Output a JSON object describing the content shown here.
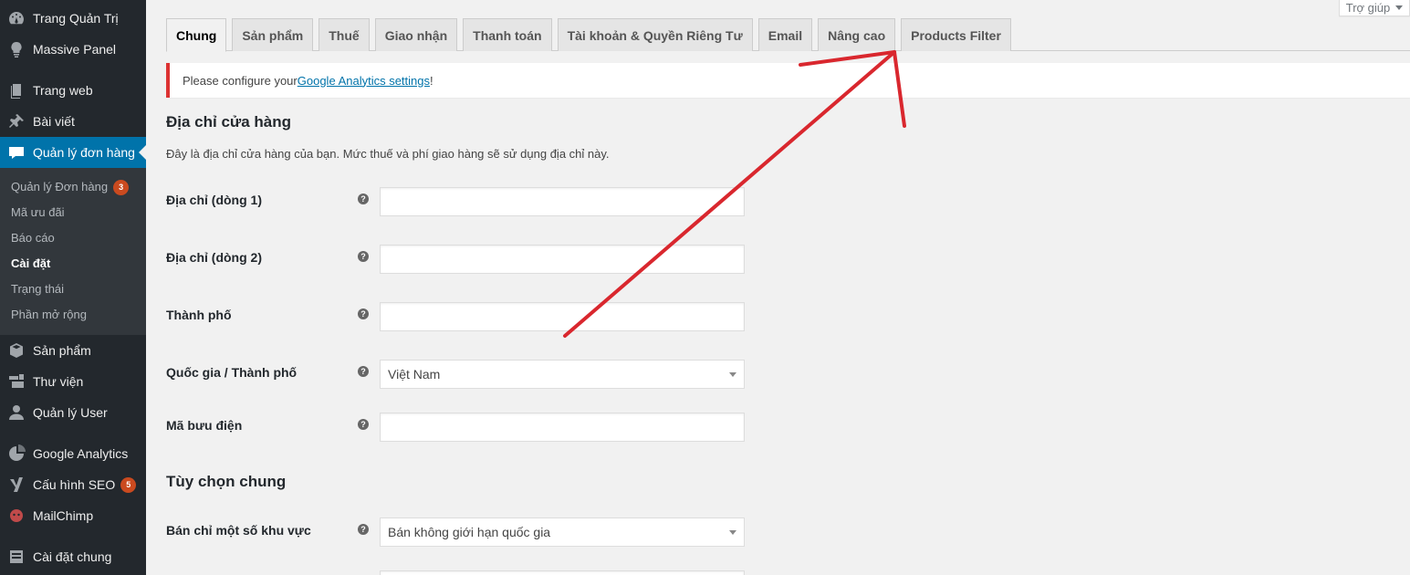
{
  "sidebar": {
    "items": [
      {
        "label": "Trang Quản Trị",
        "icon": "dashboard-icon"
      },
      {
        "label": "Massive Panel",
        "icon": "lightbulb-icon"
      },
      {
        "label": "Trang web",
        "icon": "pages-icon"
      },
      {
        "label": "Bài viết",
        "icon": "pin-icon"
      },
      {
        "label": "Quản lý đơn hàng",
        "icon": "woo-icon"
      },
      {
        "label": "Sản phẩm",
        "icon": "box-icon"
      },
      {
        "label": "Thư viện",
        "icon": "media-icon"
      },
      {
        "label": "Quản lý User",
        "icon": "user-icon"
      },
      {
        "label": "Google Analytics",
        "icon": "analytics-icon"
      },
      {
        "label": "Cấu hình SEO",
        "icon": "yoast-icon",
        "badge": "5"
      },
      {
        "label": "MailChimp",
        "icon": "mailchimp-icon"
      },
      {
        "label": "Cài đặt chung",
        "icon": "settings-icon"
      }
    ],
    "submenu": [
      {
        "label": "Quản lý Đơn hàng",
        "badge": "3"
      },
      {
        "label": "Mã ưu đãi"
      },
      {
        "label": "Báo cáo"
      },
      {
        "label": "Cài đặt"
      },
      {
        "label": "Trạng thái"
      },
      {
        "label": "Phần mở rộng"
      }
    ]
  },
  "help_tab": {
    "label": "Trợ giúp"
  },
  "tabs": [
    {
      "label": "Chung"
    },
    {
      "label": "Sản phẩm"
    },
    {
      "label": "Thuế"
    },
    {
      "label": "Giao nhận"
    },
    {
      "label": "Thanh toán"
    },
    {
      "label": "Tài khoản & Quyền Riêng Tư"
    },
    {
      "label": "Email"
    },
    {
      "label": "Nâng cao"
    },
    {
      "label": "Products Filter"
    }
  ],
  "notice": {
    "prefix": "Please configure your ",
    "link": "Google Analytics settings",
    "suffix": "!"
  },
  "store_address": {
    "title": "Địa chỉ cửa hàng",
    "description": "Đây là địa chỉ cửa hàng của bạn. Mức thuế và phí giao hàng sẽ sử dụng địa chỉ này.",
    "address1_label": "Địa chỉ (dòng 1)",
    "address1_value": "",
    "address2_label": "Địa chỉ (dòng 2)",
    "address2_value": "",
    "city_label": "Thành phố",
    "city_value": "",
    "country_label": "Quốc gia / Thành phố",
    "country_value": "Việt Nam",
    "postcode_label": "Mã bưu điện",
    "postcode_value": ""
  },
  "general_options": {
    "title": "Tùy chọn chung",
    "sell_to_label": "Bán chỉ một số khu vực",
    "sell_to_value": "Bán không giới hạn quốc gia"
  },
  "colors": {
    "sidebar_bg": "#23282d",
    "active": "#0073aa",
    "notice_border": "#dc3232",
    "annotation_arrow": "#d9272e"
  }
}
